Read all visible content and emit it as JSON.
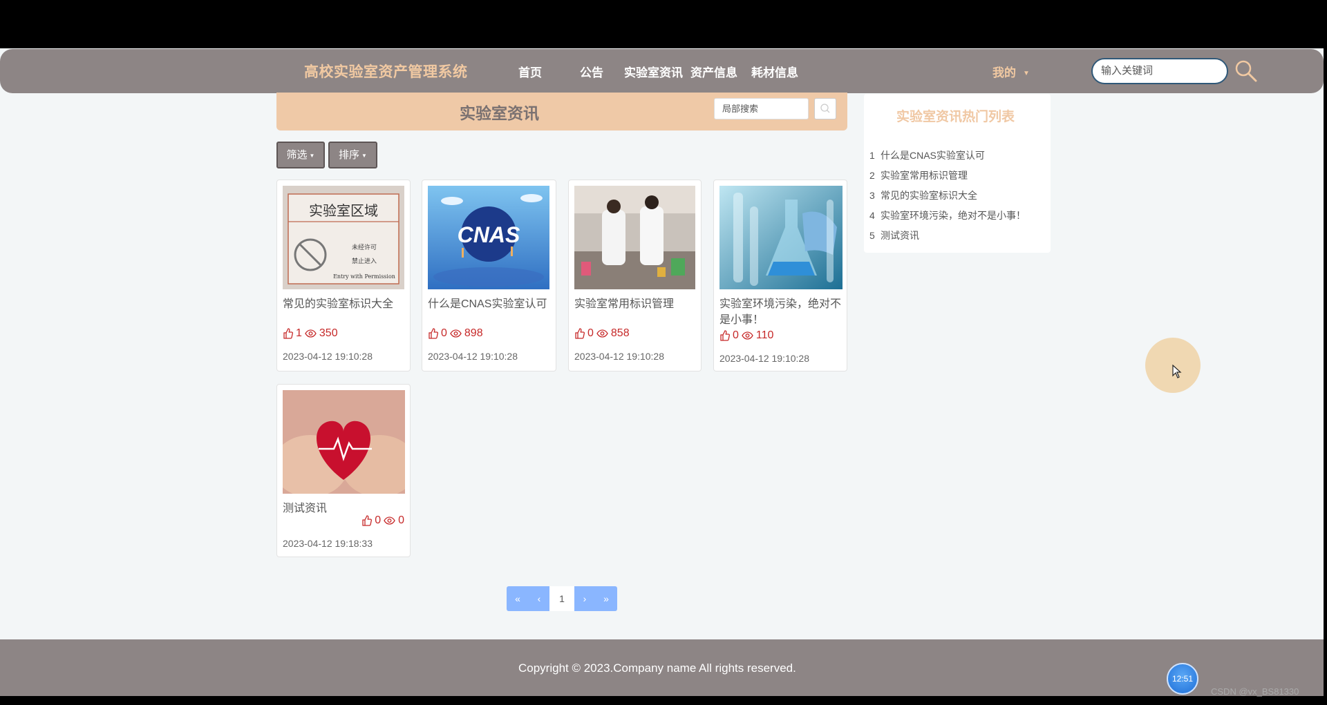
{
  "header": {
    "brand": "高校实验室资产管理系统",
    "nav": [
      "首页",
      "公告",
      "实验室资讯",
      "资产信息",
      "耗材信息"
    ],
    "mine": "我的",
    "search_placeholder": "输入关键词"
  },
  "section": {
    "title": "实验室资讯",
    "local_search_placeholder": "局部搜索"
  },
  "filters": {
    "filter_label": "筛选",
    "sort_label": "排序"
  },
  "cards": [
    {
      "title": "常见的实验室标识大全",
      "likes": "1",
      "views": "350",
      "date": "2023-04-12 19:10:28",
      "image": "lab-area-sign-image"
    },
    {
      "title": "什么是CNAS实验室认可",
      "likes": "0",
      "views": "898",
      "date": "2023-04-12 19:10:28",
      "image": "cnas-logo-image"
    },
    {
      "title": "实验室常用标识管理",
      "likes": "0",
      "views": "858",
      "date": "2023-04-12 19:10:28",
      "image": "lab-workers-image"
    },
    {
      "title": "实验室环境污染，绝对不是小事！",
      "likes": "0",
      "views": "110",
      "date": "2023-04-12 19:10:28",
      "image": "lab-glassware-image"
    },
    {
      "title": "测试资讯",
      "likes": "0",
      "views": "0",
      "date": "2023-04-12 19:18:33",
      "image": "heart-in-hands-image"
    }
  ],
  "hot_list": {
    "title": "实验室资讯热门列表",
    "items": [
      {
        "num": "1",
        "label": "什么是CNAS实验室认可"
      },
      {
        "num": "2",
        "label": "实验室常用标识管理"
      },
      {
        "num": "3",
        "label": "常见的实验室标识大全"
      },
      {
        "num": "4",
        "label": "实验室环境污染，绝对不是小事！"
      },
      {
        "num": "5",
        "label": "测试资讯"
      }
    ]
  },
  "pagination": {
    "first": "«",
    "prev": "‹",
    "current": "1",
    "next": "›",
    "last": "»"
  },
  "footer": {
    "copyright": "Copyright © 2023.Company name All rights reserved."
  },
  "overlay": {
    "clock": "12:51",
    "watermark": "CSDN @vx_BS81330"
  },
  "colors": {
    "navbar": "#8d8585",
    "accent": "#f1c9a2",
    "stats_red": "#c62828",
    "pager_blue": "#8ab6ff"
  }
}
